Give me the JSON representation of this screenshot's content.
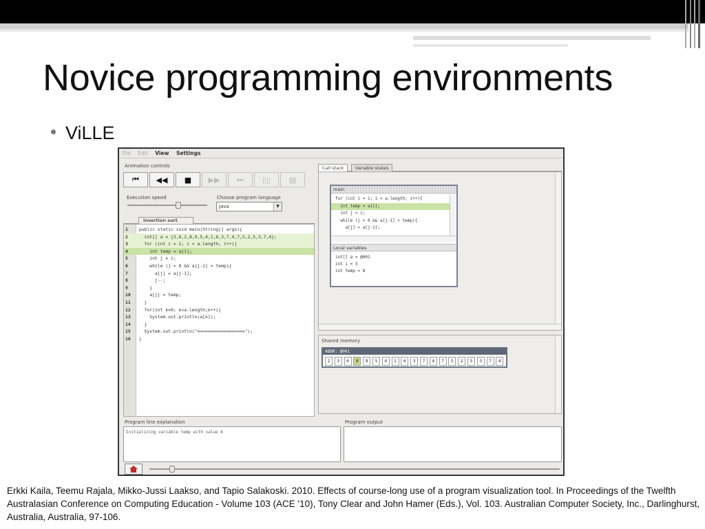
{
  "slide": {
    "title": "Novice programming environments",
    "bullet": "ViLLE",
    "citation": "Erkki Kaila, Teemu Rajala, Mikko-Jussi Laakso, and Tapio Salakoski. 2010. Effects of course-long use of a program visualization tool. In Proceedings of the Twelfth Australasian Conference on Computing Education - Volume 103 (ACE '10), Tony Clear and John Hamer (Eds.), Vol. 103. Australian Computer Society, Inc., Darlinghurst, Australia, Australia, 97-106."
  },
  "app": {
    "menu": [
      "File",
      "Edit",
      "View",
      "Settings"
    ],
    "animation_controls_label": "Animation controls",
    "controls": [
      {
        "icon": "skip-to-start-icon",
        "glyph": "⏮",
        "enabled": true
      },
      {
        "icon": "step-back-icon",
        "glyph": "◀◀",
        "enabled": true
      },
      {
        "icon": "stop-icon",
        "glyph": "■",
        "enabled": true
      },
      {
        "icon": "step-forward-icon",
        "glyph": "▶▶",
        "enabled": false
      },
      {
        "icon": "skip-to-end-icon",
        "glyph": "⏭",
        "enabled": false
      },
      {
        "icon": "split-view-icon",
        "glyph": "▯▯",
        "enabled": false
      },
      {
        "icon": "document-icon",
        "glyph": "▤",
        "enabled": false
      }
    ],
    "execution_speed_label": "Execution speed",
    "execution_speed_value": 0.65,
    "language_label": "Choose program language",
    "language_value": "Java",
    "editor_tab": "Insertion sort",
    "code_lines": [
      {
        "n": "1",
        "text": " public static void main(String[] args){",
        "hl": ""
      },
      {
        "n": "2",
        "text": "   int[] a = {3,6,2,8,9,5,4,1,6,3,7,4,7,5,2,5,3,7,4};",
        "hl": "a"
      },
      {
        "n": "3",
        "text": "   for (int i = 1; i < a.length; i++){",
        "hl": "a"
      },
      {
        "n": "4",
        "text": "     int temp = a[i];",
        "hl": "b"
      },
      {
        "n": "5",
        "text": "     int j = i;",
        "hl": ""
      },
      {
        "n": "6",
        "text": "     while (j > 0 && a[j-1] > temp){",
        "hl": ""
      },
      {
        "n": "7",
        "text": "       a[j] = a[j-1];",
        "hl": ""
      },
      {
        "n": "8",
        "text": "       j--;",
        "hl": ""
      },
      {
        "n": "9",
        "text": "     }",
        "hl": ""
      },
      {
        "n": "10",
        "text": "     a[j] = temp;",
        "hl": ""
      },
      {
        "n": "11",
        "text": "   }",
        "hl": ""
      },
      {
        "n": "12",
        "text": "   for(int k=0; k<a.length;k++){",
        "hl": ""
      },
      {
        "n": "13",
        "text": "     System.out.println(a[k]);",
        "hl": ""
      },
      {
        "n": "14",
        "text": "   }",
        "hl": ""
      },
      {
        "n": "15",
        "text": "   System.out.println(\"==================\");",
        "hl": ""
      },
      {
        "n": "16",
        "text": " }",
        "hl": ""
      }
    ],
    "right_tabs": [
      "Call stack",
      "Variable states"
    ],
    "frame_title": "main",
    "frame_lines": [
      {
        "text": "for (int i = 1; i < a.length; i++){",
        "hl": false
      },
      {
        "text": "  int temp = a[i];",
        "hl": true
      },
      {
        "text": "  int j = i;",
        "hl": false
      },
      {
        "text": "  while (j > 0 && a[j-1] > temp){",
        "hl": false
      },
      {
        "text": "    a[j] = a[j-1];",
        "hl": false
      }
    ],
    "local_vars_label": "Local variables",
    "local_vars": [
      "int[] a = @001",
      "int i = 3",
      "int temp = 8"
    ],
    "shared_memory_label": "Shared memory",
    "memory_title": "ADDR: @001",
    "memory_values": [
      "2",
      "3",
      "6",
      "8",
      "9",
      "5",
      "4",
      "1",
      "6",
      "3",
      "7",
      "4",
      "7",
      "5",
      "2",
      "5",
      "3",
      "7",
      "4"
    ],
    "memory_highlight_index": 3,
    "explanation_label": "Program line explanation",
    "explanation_text": "Initializing variable temp with value 8",
    "output_label": "Program output",
    "output_text": "",
    "timeline_value": 0.05
  }
}
